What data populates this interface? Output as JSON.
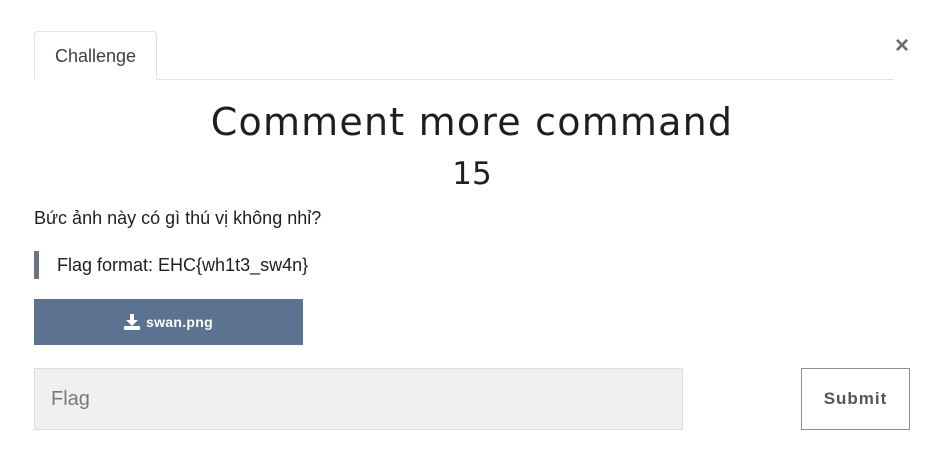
{
  "tabs": [
    {
      "label": "Challenge",
      "active": true
    }
  ],
  "close_label": "×",
  "challenge": {
    "name": "Comment more command",
    "points": "15",
    "description": "Bức ảnh này có gì thú vị không nhỉ?",
    "quote": "Flag format: EHC{wh1t3_sw4n}"
  },
  "download": {
    "filename": "swan.png",
    "icon": "download-icon"
  },
  "flag_input": {
    "placeholder": "Flag",
    "value": ""
  },
  "submit_label": "Submit",
  "colors": {
    "download_bg": "#5b7390",
    "quote_border": "#6c757d",
    "input_bg": "#f0f0f0"
  }
}
